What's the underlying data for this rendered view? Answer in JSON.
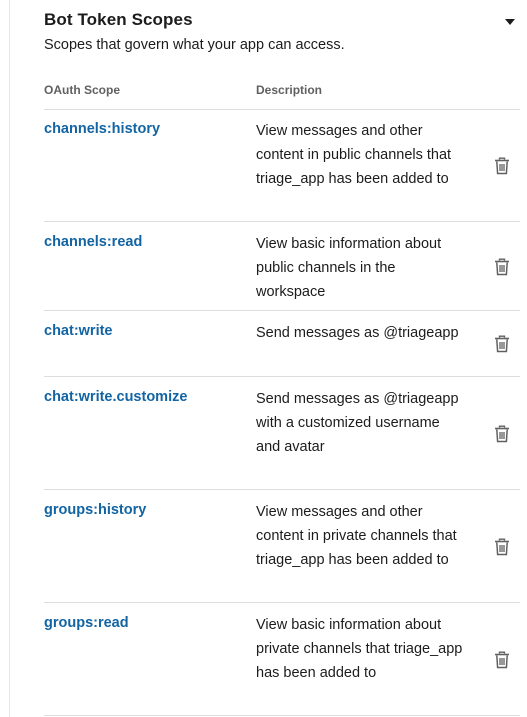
{
  "section": {
    "title": "Bot Token Scopes",
    "subtitle": "Scopes that govern what your app can access.",
    "toggle_icon": "caret-down-icon"
  },
  "columns": {
    "scope": "OAuth Scope",
    "description": "Description"
  },
  "scopes": [
    {
      "name": "channels:history",
      "description": "View messages and other content in public channels that triage_app has been added to",
      "action_icon": "trash-icon"
    },
    {
      "name": "channels:read",
      "description": "View basic information about public channels in the workspace",
      "action_icon": "trash-icon"
    },
    {
      "name": "chat:write",
      "description": "Send messages as @triageapp",
      "action_icon": "trash-icon"
    },
    {
      "name": "chat:write.customize",
      "description": "Send messages as @triageapp with a customized username and avatar",
      "action_icon": "trash-icon"
    },
    {
      "name": "groups:history",
      "description": "View messages and other content in private channels that triage_app has been added to",
      "action_icon": "trash-icon"
    },
    {
      "name": "groups:read",
      "description": "View basic information about private channels that triage_app has been added to",
      "action_icon": "trash-icon"
    }
  ],
  "colors": {
    "link": "#1264a3",
    "text": "#1d1c1d",
    "muted": "#616061",
    "divider": "#dddddd",
    "icon": "#616061"
  }
}
